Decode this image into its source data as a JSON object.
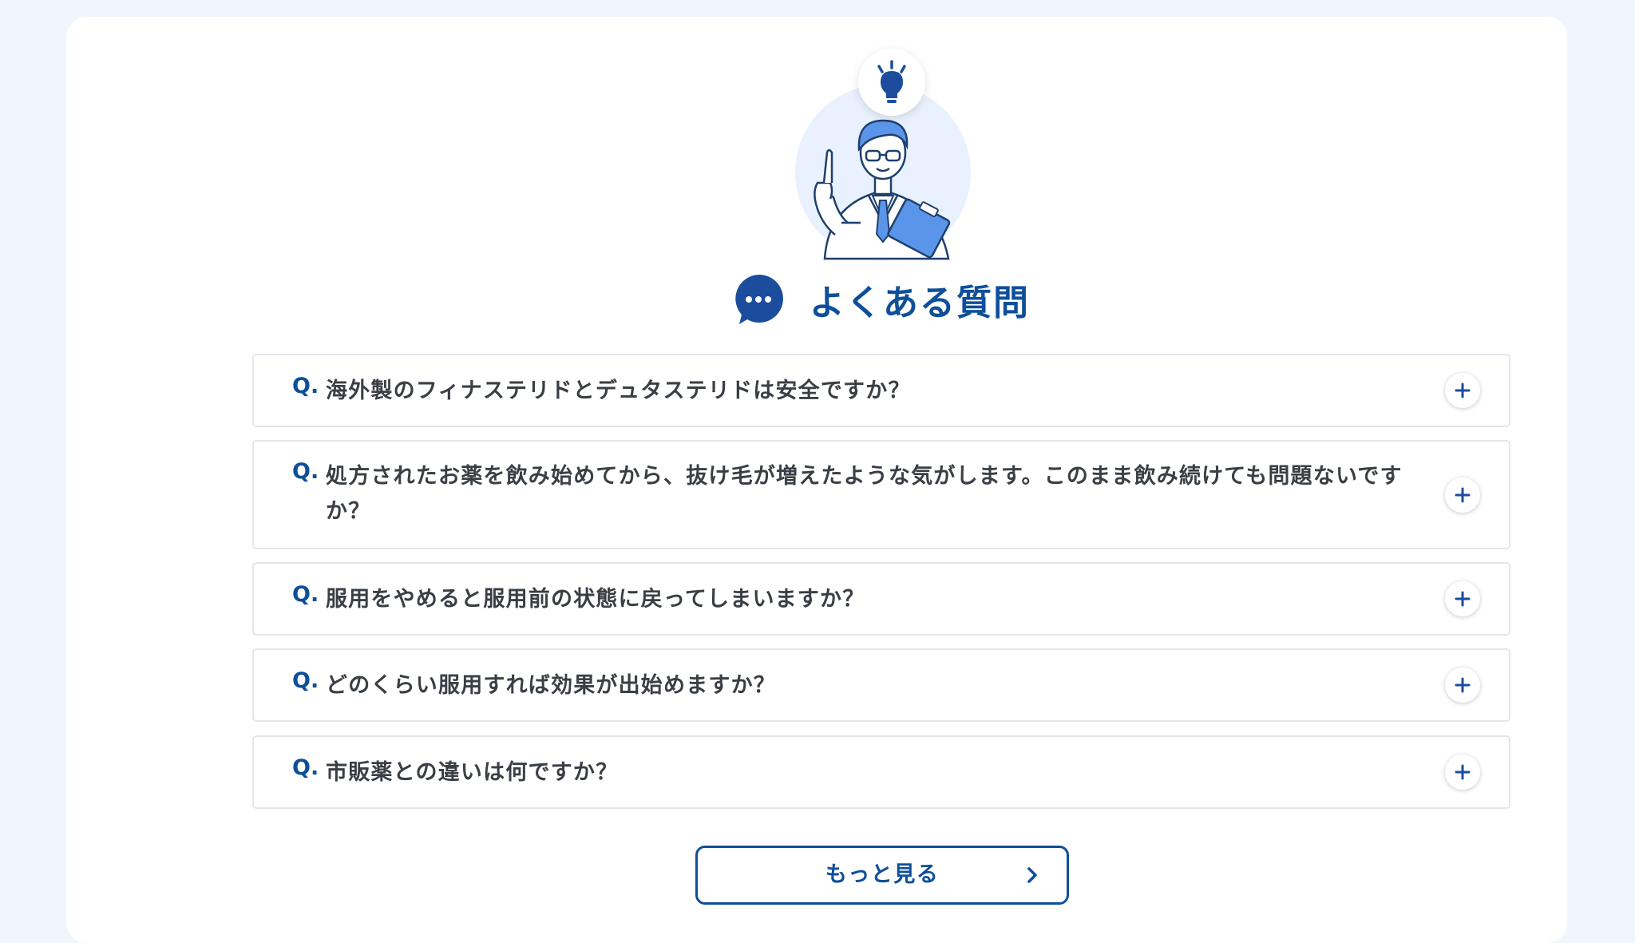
{
  "section": {
    "title": "よくある質問"
  },
  "faq": {
    "q_label": "Q.",
    "items": [
      {
        "question": "海外製のフィナステリドとデュタステリドは安全ですか？"
      },
      {
        "question": "処方されたお薬を飲み始めてから、抜け毛が増えたような気がします。このまま飲み続けても問題ないですか？"
      },
      {
        "question": "服用をやめると服用前の状態に戻ってしまいますか？"
      },
      {
        "question": "どのくらい服用すれば効果が出始めますか？"
      },
      {
        "question": "市販薬との違いは何ですか？"
      }
    ]
  },
  "more_button": {
    "label": "もっと見る"
  },
  "icons": {
    "hero": "doctor-illustration",
    "bulb": "lightbulb-icon",
    "title": "speech-bubble-icon",
    "expand": "plus-icon",
    "more": "chevron-right-icon"
  },
  "colors": {
    "background": "#f1f6fd",
    "card": "#ffffff",
    "accent": "#0e4f99",
    "illustration_blue": "#5b95ea",
    "illustration_bg": "#e8f1fd",
    "text": "#3a3f45",
    "border": "#e3e7ec"
  }
}
